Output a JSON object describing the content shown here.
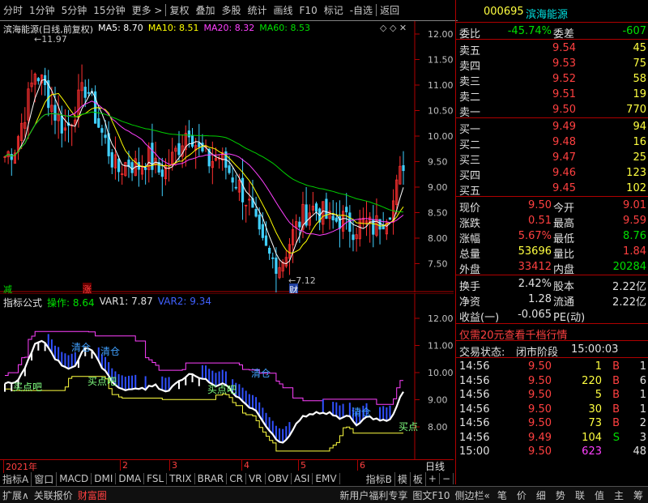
{
  "toolbar": {
    "items": [
      "分时",
      "1分钟",
      "5分钟",
      "15分钟",
      "更多",
      "复权",
      "叠加",
      "多股",
      "统计",
      "画线",
      "F10",
      "标记",
      "-自选",
      "返回"
    ]
  },
  "main": {
    "stock_title": "滨海能源(日线,前复权)",
    "ma": [
      {
        "label": "MA5: 8.70",
        "color": "#ffffff"
      },
      {
        "label": "MA10: 8.51",
        "color": "#ffff00"
      },
      {
        "label": "MA20: 8.32",
        "color": "#ff40ff"
      },
      {
        "label": "MA60: 8.53",
        "color": "#00e000"
      }
    ],
    "high_label": "11.97",
    "low_label": "7.12",
    "marker_jian": "减",
    "marker_zhang": "涨",
    "marker_cai": "财",
    "y_ticks": [
      "12.00",
      "11.50",
      "11.00",
      "10.50",
      "10.00",
      "9.50",
      "9.00",
      "8.50",
      "8.00",
      "7.50"
    ]
  },
  "indicator": {
    "title": "指标公式",
    "op": "操作: 8.64",
    "var1": "VAR1: 7.87",
    "var2": "VAR2: 9.34",
    "labels": [
      "清仓",
      "清仓",
      "买点吧",
      "买点吧",
      "买点吧",
      "清仓",
      "清仓",
      "买点"
    ],
    "y_ticks": [
      "12.00",
      "11.00",
      "10.00",
      "9.00",
      "8.00"
    ]
  },
  "timeaxis": {
    "labels": [
      "2021年",
      "2",
      "3",
      "4",
      "5",
      "6"
    ],
    "right": "日线"
  },
  "tabs": {
    "row1": [
      "指标A",
      "窗口",
      "MACD",
      "DMI",
      "DMA",
      "FSL",
      "TRIX",
      "BRAR",
      "CR",
      "VR",
      "OBV",
      "ASI",
      "EMV"
    ],
    "row1_right": [
      "指标B",
      "模",
      "板",
      "+",
      "−"
    ]
  },
  "status": {
    "left": [
      "扩展∧",
      "关联报价",
      "财富圈"
    ],
    "mid": [
      "新用户福利专享",
      "图文F10",
      "侧边栏«"
    ],
    "right": [
      "笔",
      "价",
      "细",
      "势",
      "联",
      "值",
      "主",
      "筹"
    ]
  },
  "quote": {
    "code": "000695",
    "name": "滨海能源",
    "weibi_label": "委比",
    "weibi": "-45.74%",
    "weicha_label": "委差",
    "weicha": "-607",
    "sells": [
      {
        "label": "卖五",
        "price": "9.54",
        "vol": "45"
      },
      {
        "label": "卖四",
        "price": "9.53",
        "vol": "75"
      },
      {
        "label": "卖三",
        "price": "9.52",
        "vol": "58"
      },
      {
        "label": "卖二",
        "price": "9.51",
        "vol": "19"
      },
      {
        "label": "卖一",
        "price": "9.50",
        "vol": "770"
      }
    ],
    "buys": [
      {
        "label": "买一",
        "price": "9.49",
        "vol": "94"
      },
      {
        "label": "买二",
        "price": "9.48",
        "vol": "16"
      },
      {
        "label": "买三",
        "price": "9.47",
        "vol": "25"
      },
      {
        "label": "买四",
        "price": "9.46",
        "vol": "123"
      },
      {
        "label": "买五",
        "price": "9.45",
        "vol": "102"
      }
    ],
    "stats": [
      {
        "l1": "现价",
        "v1": "9.50",
        "c1": "red",
        "l2": "今开",
        "v2": "9.01",
        "c2": "red"
      },
      {
        "l1": "涨跌",
        "v1": "0.51",
        "c1": "red",
        "l2": "最高",
        "v2": "9.59",
        "c2": "red"
      },
      {
        "l1": "涨幅",
        "v1": "5.67%",
        "c1": "red",
        "l2": "最低",
        "v2": "8.76",
        "c2": "grn"
      },
      {
        "l1": "总量",
        "v1": "53696",
        "c1": "yel",
        "l2": "量比",
        "v2": "1.84",
        "c2": "red"
      },
      {
        "l1": "外盘",
        "v1": "33412",
        "c1": "red",
        "l2": "内盘",
        "v2": "20284",
        "c2": "grn"
      }
    ],
    "stats2": [
      {
        "l1": "换手",
        "v1": "2.42%",
        "l2": "股本",
        "v2": "2.22亿"
      },
      {
        "l1": "净资",
        "v1": "1.28",
        "l2": "流通",
        "v2": "2.22亿"
      },
      {
        "l1": "收益(一)",
        "v1": "-0.065",
        "l2": "PE(动)",
        "v2": ""
      }
    ],
    "promo": "仅需20元查看千档行情",
    "trade_state_label": "交易状态:",
    "trade_state": "闭市阶段",
    "trade_time": "15:00:03",
    "ticks": [
      {
        "t": "14:56",
        "p": "9.50",
        "v": "1",
        "d": "B",
        "n": "1"
      },
      {
        "t": "14:56",
        "p": "9.50",
        "v": "220",
        "d": "B",
        "n": "6"
      },
      {
        "t": "14:56",
        "p": "9.50",
        "v": "5",
        "d": "B",
        "n": "1"
      },
      {
        "t": "14:56",
        "p": "9.50",
        "v": "30",
        "d": "B",
        "n": "1"
      },
      {
        "t": "14:56",
        "p": "9.50",
        "v": "73",
        "d": "B",
        "n": "2"
      },
      {
        "t": "14:56",
        "p": "9.49",
        "v": "104",
        "d": "S",
        "n": "3"
      },
      {
        "t": "15:00",
        "p": "9.50",
        "v": "623",
        "d": "",
        "n": "48"
      }
    ]
  }
}
